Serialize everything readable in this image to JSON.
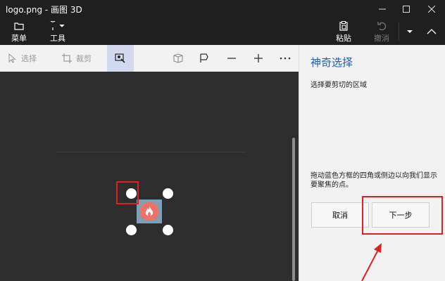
{
  "window": {
    "title": "logo.png - 画图 3D"
  },
  "ribbon": {
    "menu_label": "菜单",
    "tools_label": "工具",
    "paste_label": "粘贴",
    "undo_label": "撤消"
  },
  "toolbar": {
    "select_label": "选择",
    "crop_label": "裁剪"
  },
  "panel": {
    "title": "神奇选择",
    "subtitle": "选择要剪切的区域",
    "description": "拖动蓝色方框的四角或侧边以向我们显示要聚焦的点。",
    "cancel_label": "取消",
    "next_label": "下一步"
  },
  "colors": {
    "accent": "#1e5fb0",
    "highlight": "#e02020",
    "logo": "#f07167"
  }
}
